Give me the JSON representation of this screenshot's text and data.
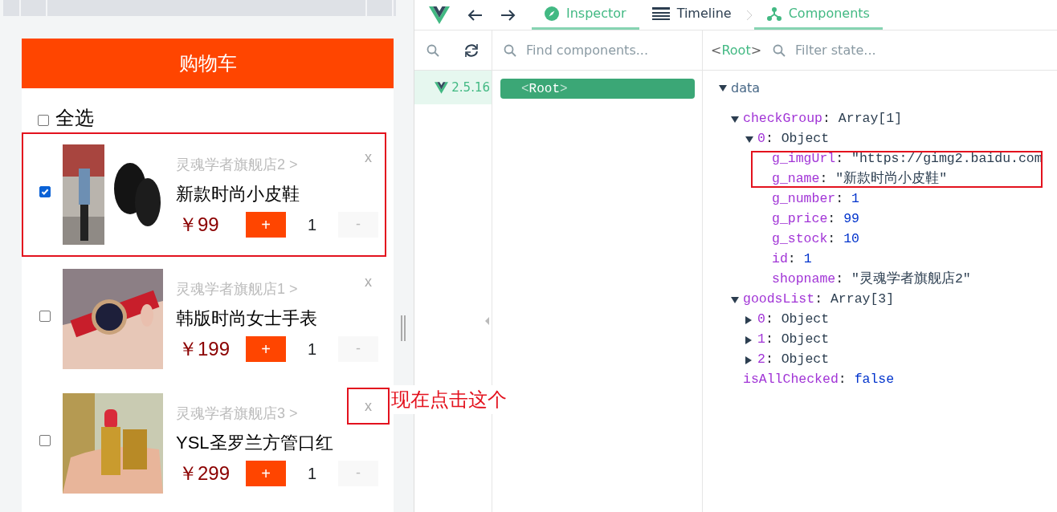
{
  "cart": {
    "title": "购物车",
    "select_all": {
      "label": "全选",
      "checked": false
    },
    "items": [
      {
        "shop": "灵魂学者旗舰店2 >",
        "name": "新款时尚小皮鞋",
        "price": "￥99",
        "plus": "+",
        "quantity": "1",
        "minus": "-",
        "remove": "x",
        "checked": true,
        "highlighted": true,
        "remove_highlighted": false
      },
      {
        "shop": "灵魂学者旗舰店1 >",
        "name": "韩版时尚女士手表",
        "price": "￥199",
        "plus": "+",
        "quantity": "1",
        "minus": "-",
        "remove": "x",
        "checked": false,
        "highlighted": false,
        "remove_highlighted": false
      },
      {
        "shop": "灵魂学者旗舰店3 >",
        "name": "YSL圣罗兰方管口红",
        "price": "￥299",
        "plus": "+",
        "quantity": "1",
        "minus": "-",
        "remove": "x",
        "checked": false,
        "highlighted": false,
        "remove_highlighted": true
      }
    ]
  },
  "annotation": {
    "text": "现在点击这个"
  },
  "devtools": {
    "tabs": [
      {
        "label": "Inspector",
        "selected": true,
        "kind": "compass"
      },
      {
        "label": "Timeline",
        "selected": false,
        "kind": "timeline"
      },
      {
        "label": "Components",
        "selected": true,
        "kind": "tree"
      }
    ],
    "component_search": {
      "placeholder": "Find components..."
    },
    "version": "2.5.16",
    "component_tree": [
      {
        "open": "<",
        "name": "Root",
        "close": ">",
        "selected": true
      }
    ],
    "selected_component": {
      "open": "<",
      "name": "Root",
      "close": ">"
    },
    "state_filter": {
      "placeholder": "Filter state..."
    },
    "state": {
      "section": "data",
      "expanded": true,
      "children": [
        {
          "key": "checkGroup",
          "colon": ":",
          "value": "Array[1]",
          "kind": "type",
          "expanded": true,
          "children": [
            {
              "key": "0",
              "colon": ":",
              "value": "Object",
              "kind": "type",
              "expanded": true,
              "children": [
                {
                  "key": "g_imgUrl",
                  "colon": ":",
                  "value": "\"https://gimg2.baidu.com",
                  "kind": "string",
                  "highlighted": true
                },
                {
                  "key": "g_name",
                  "colon": ":",
                  "value": "\"新款时尚小皮鞋\"",
                  "kind": "string",
                  "highlighted": true
                },
                {
                  "key": "g_number",
                  "colon": ":",
                  "value": "1",
                  "kind": "number",
                  "highlighted": false
                },
                {
                  "key": "g_price",
                  "colon": ":",
                  "value": "99",
                  "kind": "number",
                  "highlighted": false
                },
                {
                  "key": "g_stock",
                  "colon": ":",
                  "value": "10",
                  "kind": "number",
                  "highlighted": false
                },
                {
                  "key": "id",
                  "colon": ":",
                  "value": "1",
                  "kind": "number",
                  "highlighted": false
                },
                {
                  "key": "shopname",
                  "colon": ":",
                  "value": "\"灵魂学者旗舰店2\"",
                  "kind": "string",
                  "highlighted": false
                }
              ]
            }
          ]
        },
        {
          "key": "goodsList",
          "colon": ":",
          "value": "Array[3]",
          "kind": "type",
          "expanded": true,
          "children": [
            {
              "key": "0",
              "colon": ":",
              "value": "Object",
              "kind": "type",
              "expanded": false
            },
            {
              "key": "1",
              "colon": ":",
              "value": "Object",
              "kind": "type",
              "expanded": false
            },
            {
              "key": "2",
              "colon": ":",
              "value": "Object",
              "kind": "type",
              "expanded": false
            }
          ]
        },
        {
          "key": "isAllChecked",
          "colon": ":",
          "value": "false",
          "kind": "number",
          "highlighted": false
        }
      ]
    }
  }
}
